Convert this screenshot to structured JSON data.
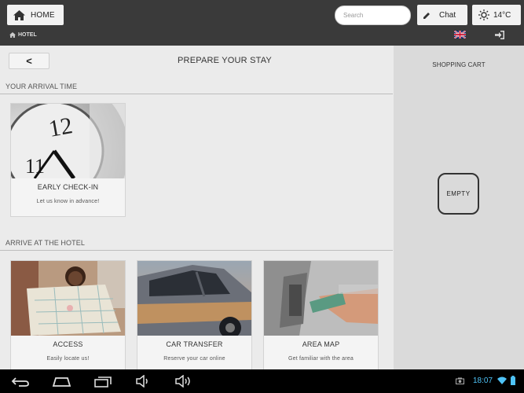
{
  "header": {
    "home_label": "HOME",
    "search_placeholder": "Search",
    "chat_label": "Chat",
    "temperature": "14°C",
    "breadcrumb": "HOTEL"
  },
  "main": {
    "back_label": "<",
    "page_title": "PREPARE YOUR STAY",
    "sections": [
      {
        "title": "YOUR ARRIVAL TIME",
        "cards": [
          {
            "title": "EARLY CHECK-IN",
            "subtitle": "Let us know in advance!"
          }
        ]
      },
      {
        "title": "ARRIVE AT THE HOTEL",
        "cards": [
          {
            "title": "ACCESS",
            "subtitle": "Easily locate us!"
          },
          {
            "title": "CAR TRANSFER",
            "subtitle": "Reserve your car online"
          },
          {
            "title": "AREA MAP",
            "subtitle": "Get familiar with the area"
          }
        ]
      }
    ]
  },
  "cart": {
    "title": "SHOPPING CART",
    "empty_label": "EMPTY"
  },
  "system_bar": {
    "time": "18:07"
  },
  "colors": {
    "topbar": "#3a3a3a",
    "clock": "#4fc3f7"
  }
}
